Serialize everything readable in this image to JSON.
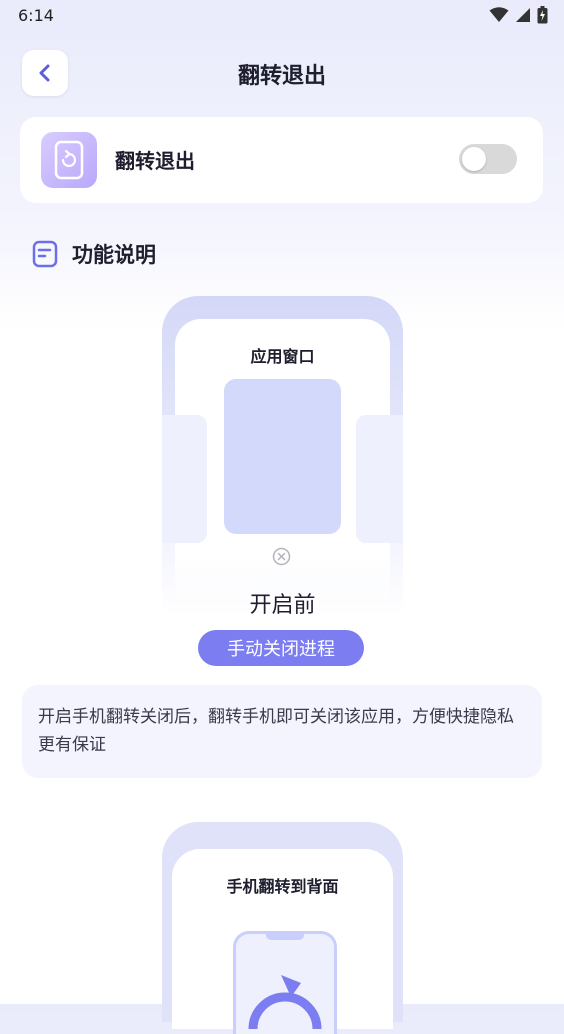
{
  "status_bar": {
    "time": "6:14"
  },
  "header": {
    "title": "翻转退出",
    "back_icon": "chevron-left-icon"
  },
  "setting": {
    "label": "翻转退出",
    "icon": "phone-rotate-icon",
    "enabled": false
  },
  "section": {
    "title": "功能说明",
    "icon": "document-icon"
  },
  "demo_before": {
    "heading": "应用窗口",
    "state_label": "开启前"
  },
  "action": {
    "label": "手动关闭进程"
  },
  "description": {
    "text": "开启手机翻转关闭后，翻转手机即可关闭该应用，方便快捷隐私更有保证"
  },
  "demo_after": {
    "heading": "手机翻转到背面"
  },
  "colors": {
    "accent": "#7b7df0",
    "window": "#d3d9fb",
    "background": "#f3f4fd"
  }
}
